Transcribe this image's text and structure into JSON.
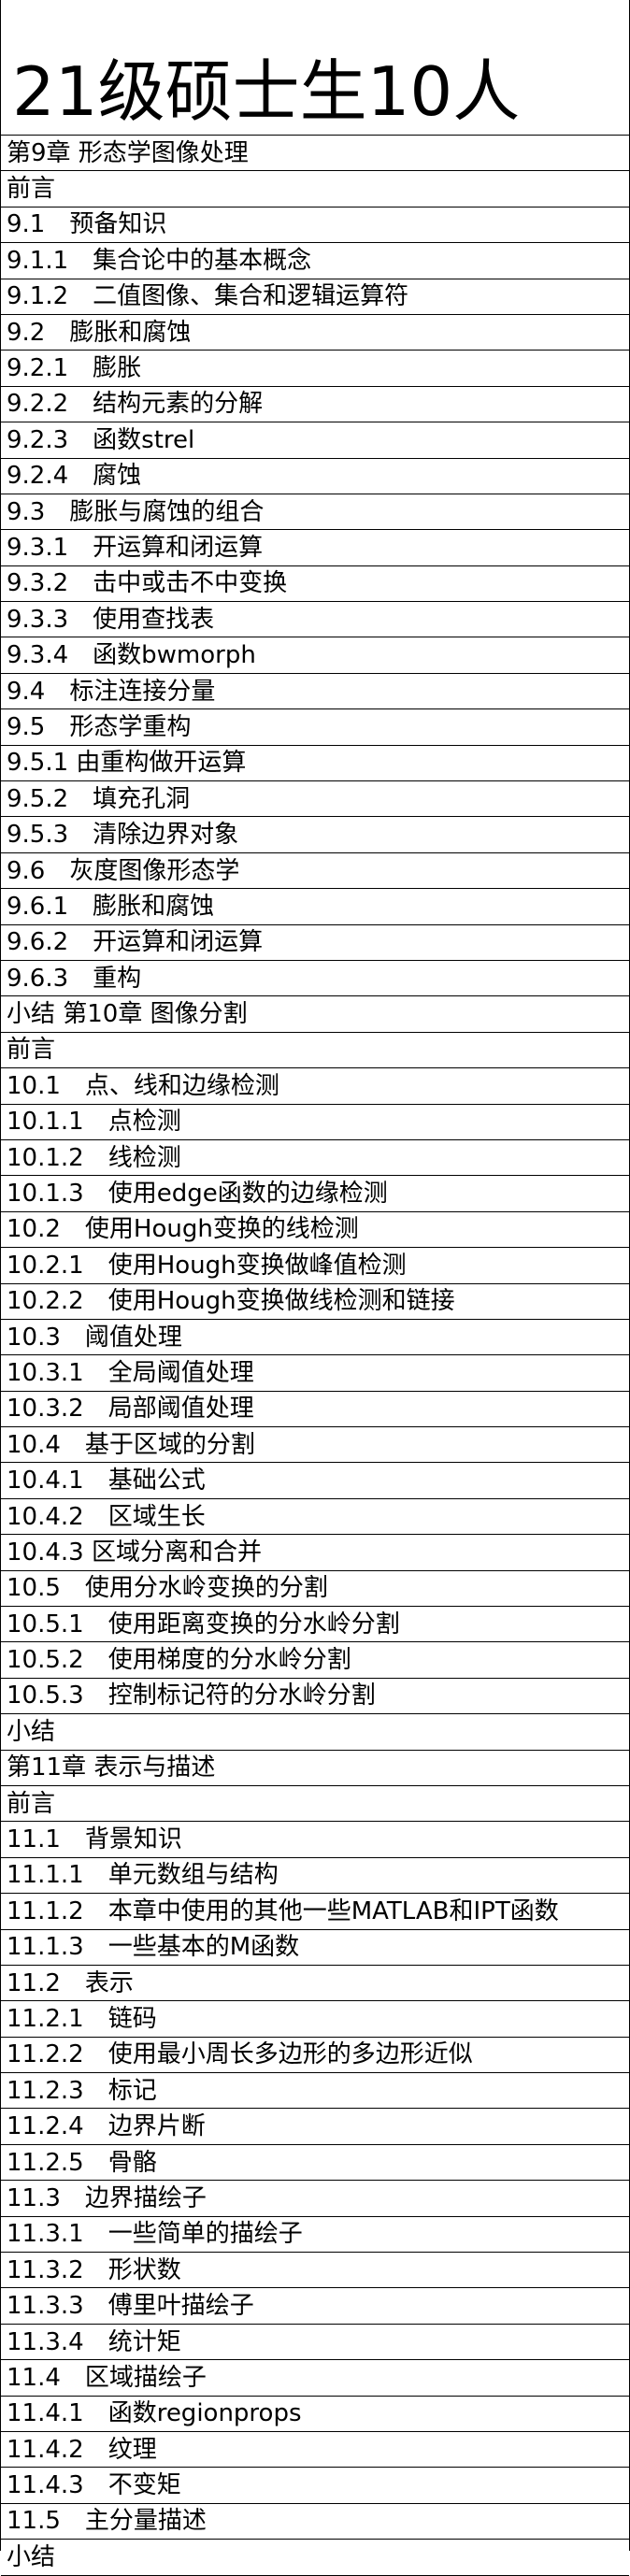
{
  "title": "21级硕士生10人",
  "rows": [
    "第9章 形态学图像处理",
    "前言",
    "9.1　预备知识",
    "9.1.1　集合论中的基本概念",
    "9.1.2　二值图像、集合和逻辑运算符",
    "9.2　膨胀和腐蚀",
    "9.2.1　膨胀",
    "9.2.2　结构元素的分解",
    "9.2.3　函数strel",
    "9.2.4　腐蚀",
    "9.3　膨胀与腐蚀的组合",
    "9.3.1　开运算和闭运算",
    "9.3.2　击中或击不中变换",
    "9.3.3　使用查找表",
    "9.3.4　函数bwmorph",
    "9.4　标注连接分量",
    "9.5　形态学重构",
    "9.5.1 由重构做开运算",
    "9.5.2　填充孔洞",
    "9.5.3　清除边界对象",
    "9.6　灰度图像形态学",
    "9.6.1　膨胀和腐蚀",
    "9.6.2　开运算和闭运算",
    "9.6.3　重构",
    "小结 第10章 图像分割",
    "前言",
    "10.1　点、线和边缘检测",
    "10.1.1　点检测",
    "10.1.2　线检测",
    "10.1.3　使用edge函数的边缘检测",
    "10.2　使用Hough变换的线检测",
    "10.2.1　使用Hough变换做峰值检测",
    "10.2.2　使用Hough变换做线检测和链接",
    "10.3　阈值处理",
    "10.3.1　全局阈值处理",
    "10.3.2　局部阈值处理",
    "10.4　基于区域的分割",
    "10.4.1　基础公式",
    "10.4.2　区域生长",
    "10.4.3 区域分离和合并",
    "10.5　使用分水岭变换的分割",
    "10.5.1　使用距离变换的分水岭分割",
    "10.5.2　使用梯度的分水岭分割",
    "10.5.3　控制标记符的分水岭分割",
    "小结",
    "第11章 表示与描述",
    "前言",
    "11.1　背景知识",
    "11.1.1　单元数组与结构",
    "11.1.2　本章中使用的其他一些MATLAB和IPT函数",
    "11.1.3　一些基本的M函数",
    "11.2　表示",
    "11.2.1　链码",
    "11.2.2　使用最小周长多边形的多边形近似",
    "11.2.3　标记",
    "11.2.4　边界片断",
    "11.2.5　骨骼",
    "11.3　边界描绘子",
    "11.3.1　一些简单的描绘子",
    "11.3.2　形状数",
    "11.3.3　傅里叶描绘子",
    "11.3.4　统计矩",
    "11.4　区域描绘子",
    "11.4.1　函数regionprops",
    "11.4.2　纹理",
    "11.4.3　不变矩",
    "11.5　主分量描述",
    "小结"
  ]
}
